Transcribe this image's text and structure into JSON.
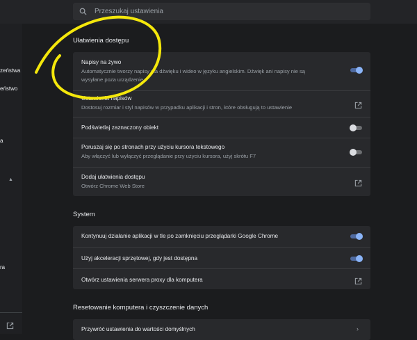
{
  "search": {
    "placeholder": "Przeszukaj ustawienia"
  },
  "sidebar": {
    "items": [
      "zeństwa",
      "eństwo",
      "a",
      "ra"
    ]
  },
  "accessibility": {
    "title": "Ułatwienia dostępu",
    "rows": [
      {
        "title": "Napisy na żywo",
        "desc1": "Automatycznie tworzy napisy dla dźwięku i wideo w języku angielskim. Dźwięk ani napisy nie są",
        "desc2": "wysyłane poza urządzenie",
        "control": "toggle",
        "on": true
      },
      {
        "title": "Ustawienia napisów",
        "desc1": "Dostosuj rozmiar i styl napisów w przypadku aplikacji i stron, które obsługują to ustawienie",
        "control": "external-link"
      },
      {
        "title": "Podświetlaj zaznaczony obiekt",
        "control": "toggle",
        "on": false
      },
      {
        "title": "Poruszaj się po stronach przy użyciu kursora tekstowego",
        "desc1": "Aby włączyć lub wyłączyć przeglądanie przy użyciu kursora, użyj skrótu F7",
        "control": "toggle",
        "on": false
      },
      {
        "title": "Dodaj ułatwienia dostępu",
        "desc1": "Otwórz Chrome Web Store",
        "control": "external-link"
      }
    ]
  },
  "system": {
    "title": "System",
    "rows": [
      {
        "title": "Kontynuuj działanie aplikacji w tle po zamknięciu przeglądarki Google Chrome",
        "control": "toggle",
        "on": true
      },
      {
        "title": "Użyj akceleracji sprzętowej, gdy jest dostępna",
        "control": "toggle",
        "on": true
      },
      {
        "title": "Otwórz ustawienia serwera proxy dla komputera",
        "control": "external-link"
      }
    ]
  },
  "reset": {
    "title": "Resetowanie komputera i czyszczenie danych",
    "rows": [
      {
        "title": "Przywróć ustawienia do wartości domyślnych",
        "control": "chevron"
      }
    ]
  },
  "colors": {
    "accent": "#8ab4f8",
    "annotation": "#f4e70b",
    "background": "#1b1c1e",
    "card": "#28292c"
  },
  "icons": {
    "search": "search-icon",
    "external": "external-link-icon",
    "chevron": "chevron-right-icon",
    "collapse": "chevron-up-icon"
  }
}
